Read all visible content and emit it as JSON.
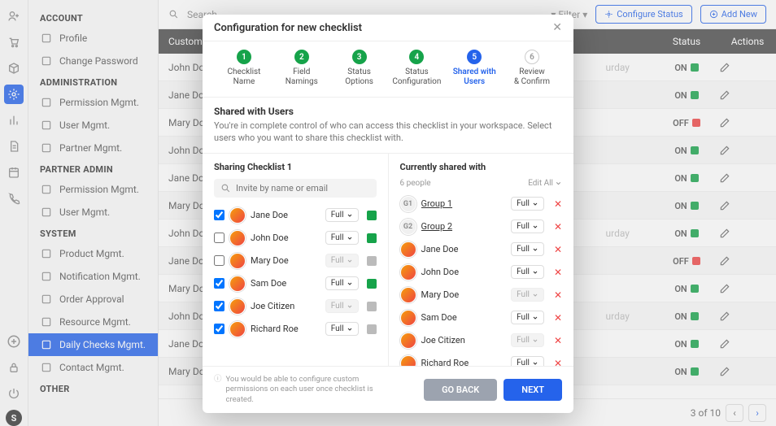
{
  "sidebar": {
    "sections": [
      {
        "title": "ACCOUNT",
        "items": [
          {
            "label": "Profile"
          },
          {
            "label": "Change Password"
          }
        ]
      },
      {
        "title": "ADMINISTRATION",
        "items": [
          {
            "label": "Permission Mgmt."
          },
          {
            "label": "User Mgmt."
          },
          {
            "label": "Partner Mgmt."
          }
        ]
      },
      {
        "title": "PARTNER ADMIN",
        "items": [
          {
            "label": "Permission Mgmt."
          },
          {
            "label": "User Mgmt."
          }
        ]
      },
      {
        "title": "SYSTEM",
        "items": [
          {
            "label": "Product Mgmt."
          },
          {
            "label": "Notification Mgmt."
          },
          {
            "label": "Order Approval"
          },
          {
            "label": "Resource Mgmt."
          },
          {
            "label": "Daily Checks Mgmt.",
            "selected": true
          },
          {
            "label": "Contact Mgmt."
          }
        ]
      },
      {
        "title": "OTHER",
        "items": []
      }
    ]
  },
  "topbar": {
    "search_placeholder": "Search",
    "filter": "Filter",
    "configure": "Configure Status",
    "addnew": "Add New"
  },
  "table": {
    "headers": {
      "customer": "Customer",
      "status": "Status",
      "actions": "Actions"
    },
    "rows": [
      {
        "name": "John Doe",
        "day": "urday",
        "status": "ON",
        "on": true
      },
      {
        "name": "Jane Doe",
        "day": "",
        "status": "ON",
        "on": true
      },
      {
        "name": "Mary Doe",
        "day": "",
        "status": "OFF",
        "on": false
      },
      {
        "name": "John Doe",
        "day": "",
        "status": "ON",
        "on": true
      },
      {
        "name": "Jane Doe",
        "day": "",
        "status": "ON",
        "on": true
      },
      {
        "name": "Mary Doe",
        "day": "",
        "status": "ON",
        "on": true
      },
      {
        "name": "John Doe",
        "day": "urday",
        "status": "ON",
        "on": true
      },
      {
        "name": "Jane Doe",
        "day": "",
        "status": "OFF",
        "on": false
      },
      {
        "name": "Mary Doe",
        "day": "",
        "status": "ON",
        "on": true
      },
      {
        "name": "John Doe",
        "day": "urday",
        "status": "ON",
        "on": true
      },
      {
        "name": "Jane Doe",
        "day": "",
        "status": "ON",
        "on": true
      },
      {
        "name": "Mary Doe",
        "day": "",
        "status": "ON",
        "on": true
      }
    ],
    "pager": "3 of 10"
  },
  "modal": {
    "title": "Configuration for new checklist",
    "steps": [
      {
        "n": "1",
        "label": "Checklist\nName",
        "state": "done"
      },
      {
        "n": "2",
        "label": "Field\nNamings",
        "state": "done"
      },
      {
        "n": "3",
        "label": "Status\nOptions",
        "state": "done"
      },
      {
        "n": "4",
        "label": "Status\nConfiguration",
        "state": "done"
      },
      {
        "n": "5",
        "label": "Shared with\nUsers",
        "state": "active"
      },
      {
        "n": "6",
        "label": "Review\n& Confirm",
        "state": "todo"
      }
    ],
    "section_title": "Shared with Users",
    "section_desc": "You're in complete control of who can access this checklist in your workspace. Select users who you want to share this checklist with.",
    "left": {
      "title": "Sharing Checklist 1",
      "invite_placeholder": "Invite by name or email",
      "users": [
        {
          "name": "Jane Doe",
          "checked": true,
          "perm": "Full",
          "enabled": true,
          "g": true
        },
        {
          "name": "John Doe",
          "checked": false,
          "perm": "Full",
          "enabled": true,
          "g": true
        },
        {
          "name": "Mary Doe",
          "checked": false,
          "perm": "Full",
          "enabled": false,
          "g": false
        },
        {
          "name": "Sam Doe",
          "checked": true,
          "perm": "Full",
          "enabled": true,
          "g": true
        },
        {
          "name": "Joe Citizen",
          "checked": true,
          "perm": "Full",
          "enabled": false,
          "g": false
        },
        {
          "name": "Richard Roe",
          "checked": true,
          "perm": "Full",
          "enabled": true,
          "g": false
        }
      ]
    },
    "right": {
      "title": "Currently shared with",
      "count": "6 people",
      "editall": "Edit All",
      "users": [
        {
          "name": "Group 1",
          "group": "G1",
          "perm": "Full",
          "enabled": true
        },
        {
          "name": "Group 2",
          "group": "G2",
          "perm": "Full",
          "enabled": true
        },
        {
          "name": "Jane Doe",
          "perm": "Full",
          "enabled": true
        },
        {
          "name": "John Doe",
          "perm": "Full",
          "enabled": true
        },
        {
          "name": "Mary Doe",
          "perm": "Full",
          "enabled": false
        },
        {
          "name": "Sam Doe",
          "perm": "Full",
          "enabled": true
        },
        {
          "name": "Joe Citizen",
          "perm": "Full",
          "enabled": false
        },
        {
          "name": "Richard Roe",
          "perm": "Full",
          "enabled": true
        }
      ]
    },
    "footnote": "You would be able to configure custom permissions on each user once checklist is created.",
    "back": "GO BACK",
    "next": "NEXT"
  }
}
